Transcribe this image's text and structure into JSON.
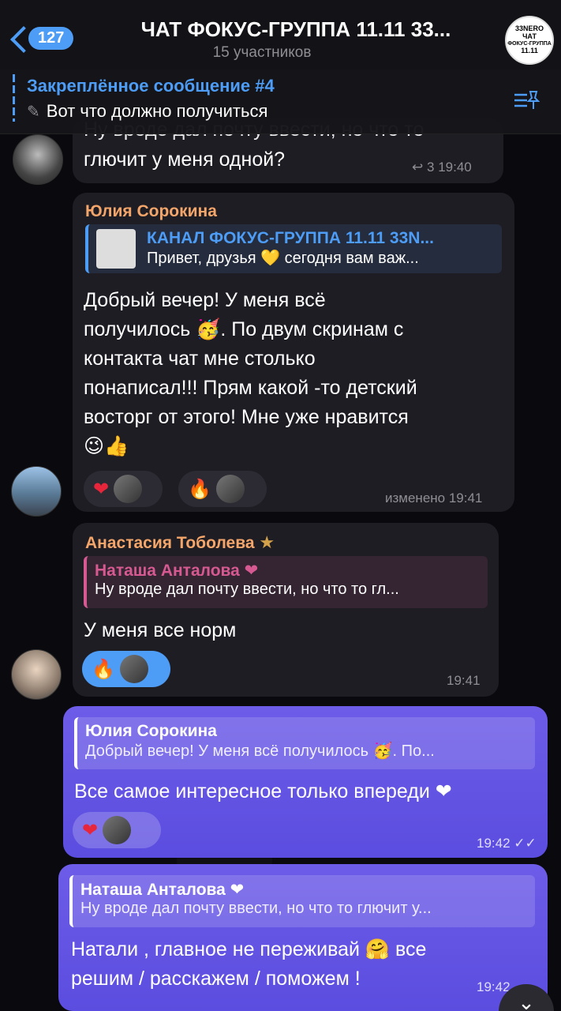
{
  "header": {
    "back_count": "127",
    "title": "ЧАТ ФОКУС-ГРУППА 11.11 33...",
    "subtitle": "15 участников",
    "avatar_text_1": "33NERO",
    "avatar_text_2": "ЧАТ",
    "avatar_text_3": "ФОКУС-ГРУППА",
    "avatar_text_4": "11.11"
  },
  "pinned": {
    "title": "Закреплённое сообщение #4",
    "text": "Вот что должно получиться"
  },
  "messages": [
    {
      "partial_text_top": "Ну вроде дал почту ввести, но что то",
      "text": "глючит у меня одной?",
      "replies_count": "3",
      "time": "19:40"
    },
    {
      "sender": "Юлия Сорокина",
      "reply_name": "КАНАЛ ФОКУС-ГРУППА 11.11 33N...",
      "reply_text": "Привет, друзья 💛 сегодня вам важ...",
      "text_lines": [
        "Добрый вечер! У меня всё",
        "получилось 🥳. По двум скринам с",
        "контакта чат мне столько",
        "понаписал!!! Прям какой -то детский",
        "восторг от этого! Мне уже нравится",
        "😉👍"
      ],
      "reaction_1": "❤",
      "reaction_2": "🔥",
      "time": "изменено 19:41"
    },
    {
      "sender": "Анастасия Тоболева",
      "sender_badge": "★",
      "reply_name": "Наташа Анталова ❤",
      "reply_text": "Ну вроде дал почту ввести, но что то гл...",
      "text": "У меня все норм",
      "reaction_1": "🔥",
      "time": "19:41"
    },
    {
      "reply_name": "Юлия Сорокина",
      "reply_text": "Добрый вечер! У меня всё получилось 🥳. По...",
      "text": "Все самое интересное только впереди ❤",
      "reaction_1": "❤",
      "time": "19:42"
    },
    {
      "reply_name": "Наташа Анталова ❤",
      "reply_text": "Ну вроде дал почту ввести, но что то глючит у...",
      "text_lines": [
        "Натали , главное не переживай 🤗 все",
        "решим / расскажем / поможем !"
      ],
      "time": "19:42"
    }
  ]
}
